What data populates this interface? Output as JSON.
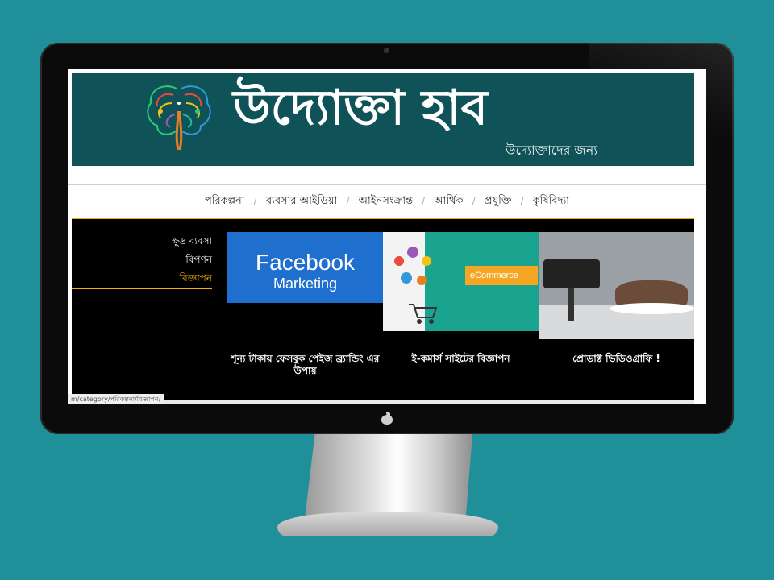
{
  "site": {
    "title": "উদ্যোক্তা হাব",
    "tagline": "উদ্যোক্তাদের জন্য"
  },
  "nav": {
    "items": [
      "পরিকল্পনা",
      "ব্যবসার আইডিয়া",
      "আইনসংক্রান্ত",
      "আর্থিক",
      "প্রযুক্তি",
      "কৃষিবিদ্যা"
    ],
    "separator": "/"
  },
  "submenu": {
    "items": [
      "ক্ষুদ্র ব্যবসা",
      "বিপণন",
      "বিজ্ঞাপন"
    ]
  },
  "cards": [
    {
      "thumb_line1": "Facebook",
      "thumb_line2": "Marketing",
      "caption": "শূন্য টাকায় ফেসবুক পেইজ ব্র্যান্ডিং এর উপায়"
    },
    {
      "thumb_label": "eCommerce",
      "caption": "ই-কমার্স সাইটের বিজ্ঞাপন"
    },
    {
      "caption": "প্রোডাক্ট ভিডিওগ্রাফি !"
    }
  ],
  "status_url": "m/category/পরিকল্পনা/বিজ্ঞাপন/",
  "colors": {
    "banner": "#0f5358",
    "accent": "#f0b400",
    "background": "#1f8f9a"
  }
}
